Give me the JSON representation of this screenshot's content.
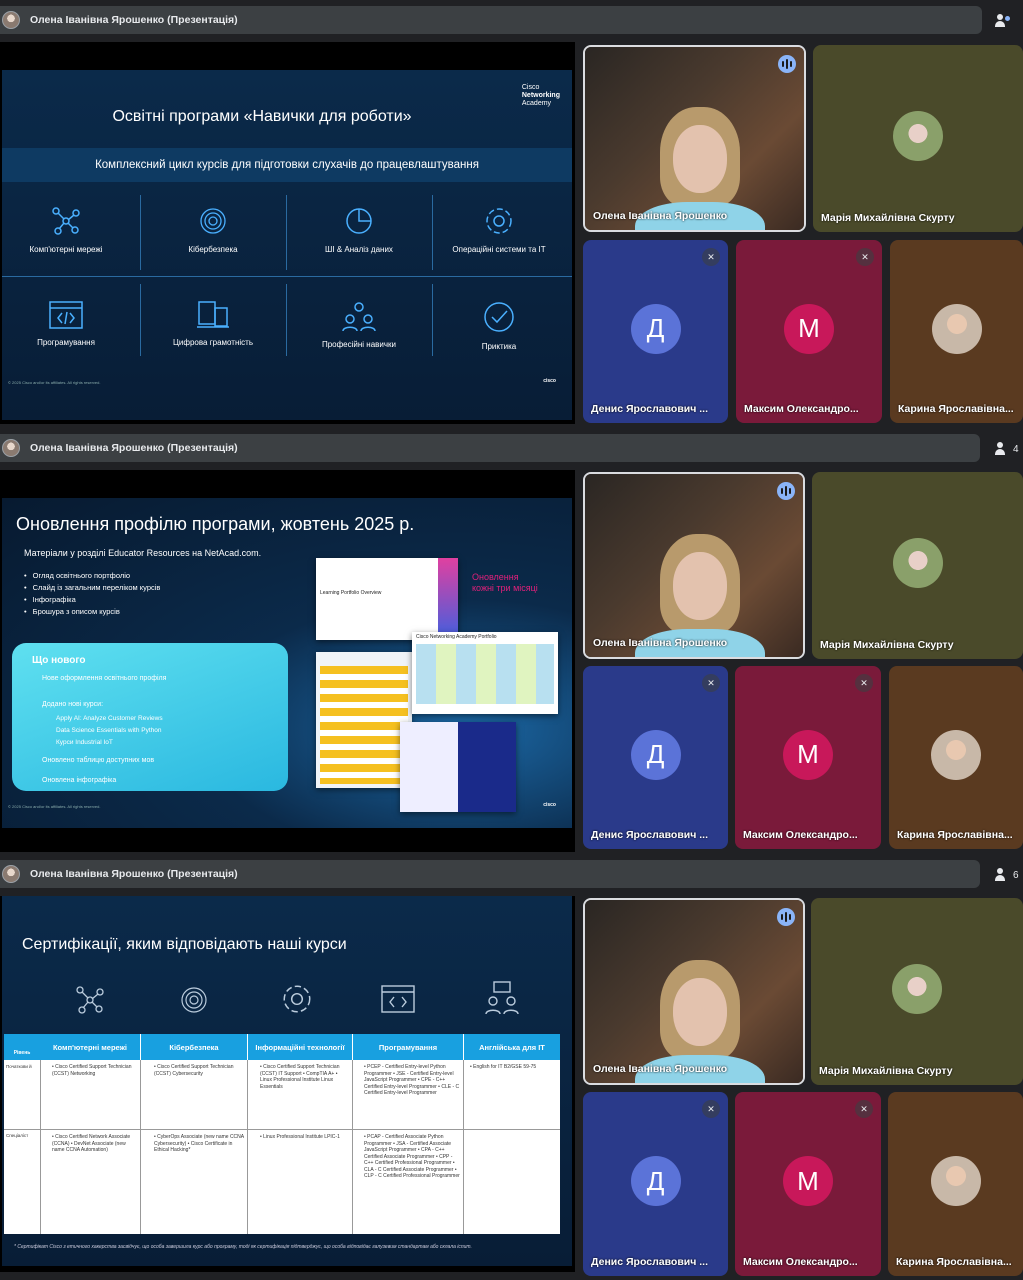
{
  "presenter_title": "Олена Іванівна Ярошенко (Презентація)",
  "participant_counts": [
    "",
    "4",
    "6"
  ],
  "participants": {
    "speaker": "Олена Іванівна Ярошенко",
    "p2": "Марія Михайлівна Скурту",
    "p3": "Денис Ярославович ...",
    "p3_initial": "Д",
    "p4": "Максим Олександро...",
    "p4_initial": "М",
    "p5": "Карина Ярославівна..."
  },
  "slide1": {
    "title": "Освітні програми «Навички для роботи»",
    "logo": [
      "Cisco",
      "Networking",
      "Academy"
    ],
    "band": "Комплексний цикл курсів для підготовки слухачів до працевлаштування",
    "cells": [
      "Комп'ютерні мережі",
      "Кібербезпека",
      "ШІ & Аналіз даних",
      "Операційні системи та ІТ",
      "Програмування",
      "Цифрова грамотність",
      "Професійні навички",
      "Приктика"
    ],
    "footer": "© 2025 Cisco and/or its affiliates. All rights reserved.",
    "cisco": "cisco"
  },
  "slide2": {
    "title": "Оновлення профілю програми, жовтень 2025 р.",
    "sub": "Матеріали у розділі Educator Resources на NetAcad.com.",
    "bullets": [
      "Огляд освітнього портфоліо",
      "Слайд із загальним переліком курсів",
      "Інфографіка",
      "Брошура з описом курсів"
    ],
    "new_head": "Що нового",
    "new_items": [
      "Нове оформлення освітнього профіля",
      "Додано нові курси:",
      "Apply AI: Analyze Customer Reviews",
      "Data Science Essentials with Python",
      "Курси Industrial IoT",
      "Оновлено таблицю доступних мов",
      "Оновлена інфографіка"
    ],
    "pink": [
      "Оновлення",
      "кожні три місяці"
    ],
    "doc1": "Learning Portfolio Overview",
    "doc2": "Cisco Networking Academy Portfolio",
    "footer": "© 2025 Cisco and/or its affiliates. All rights reserved.",
    "cisco": "cisco"
  },
  "slide3": {
    "title": "Сертифікації, яким відповідають наші курси",
    "level_head": "Рівень",
    "headers": [
      "Комп'ютерні мережі",
      "Кібербезпека",
      "Інформаційні технології",
      "Програмування",
      "Англійська для ІТ"
    ],
    "rows": [
      {
        "level": "Початкови й",
        "cells": [
          "• Cisco Certified Support Technician (CCST) Networking",
          "• Cisco Certified Support Technician (CCST) Cybersecurity",
          "• Cisco Certified Support Technician (CCST) IT Support • CompTIA A+ • Linux Professional Institute Linux Essentials",
          "• PCEP - Certified Entry-level Python Programmer • JSE - Certified Entry-level JavaScript Programmer • CPE - C++ Certified Entry-level Programmer • CLE - C Certified Entry-level Programmer",
          "• English for IT B2/GSE 59-75"
        ]
      },
      {
        "level": "Спеціаліст",
        "cells": [
          "• Cisco Certified Network Associate (CCNA) • DevNet Associate (new name CCNA Automation)",
          "• CyberOps Associate (new name CCNA Cybersecurity) • Cisco Certificate in Ethical Hacking*",
          "• Linux Professional Institute LPIC-1",
          "• PCAP - Certified Associate Python Programmer • JSA - Certified Associate JavaScript Programmer • CPA - C++ Certified Associate Programmer • CPP - C++ Certified Professional Programmer • CLA - C Certified Associate Programmer • CLP - C Certified Professional Programmer",
          ""
        ]
      }
    ],
    "footnote": "* Сертифікат Cisco з етичного хакерства засвідчує, що особа завершила курс або програму, тоді як сертифікація підтверджує, що особа відповідає галузевим стандартам або склала іспит."
  }
}
